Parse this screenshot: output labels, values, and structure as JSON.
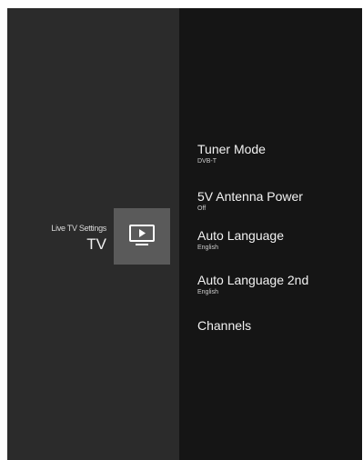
{
  "breadcrumb": {
    "section": "Live TV Settings",
    "title": "TV"
  },
  "icon": {
    "name": "tv-play-icon"
  },
  "menu": {
    "items": [
      {
        "label": "Tuner Mode",
        "value": "DVB-T"
      },
      {
        "label": "5V Antenna Power",
        "value": "Off"
      },
      {
        "label": "Auto Language",
        "value": "English"
      },
      {
        "label": "Auto Language 2nd",
        "value": "English"
      },
      {
        "label": "Channels",
        "value": ""
      }
    ]
  },
  "colors": {
    "left_panel": "#2b2b2b",
    "right_panel": "#151515",
    "tile": "#5a5a5a",
    "text": "#f2f2f2"
  }
}
